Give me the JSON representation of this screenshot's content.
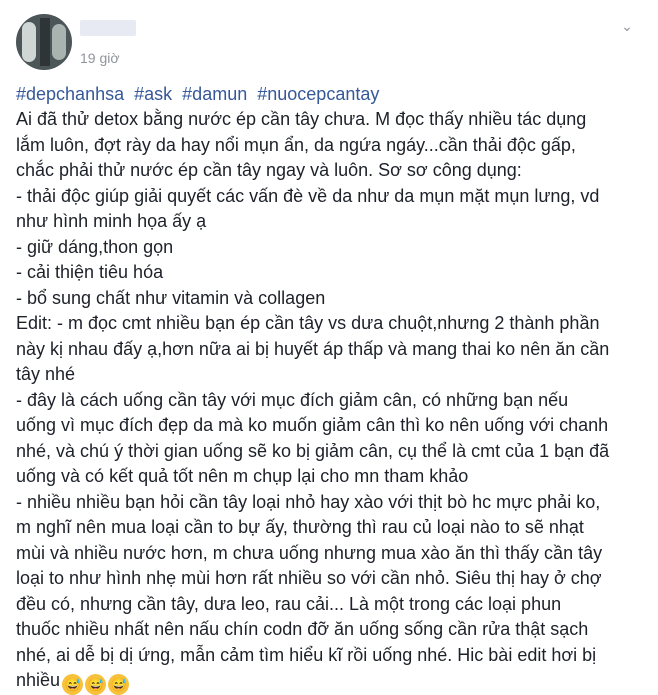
{
  "post": {
    "time": "19 giờ",
    "hashtags": [
      "#depchanhsa",
      "#ask",
      "#damun",
      "#nuocepcantay"
    ],
    "lines": [
      "Ai đã thử detox bằng nước ép cần tây chưa. M đọc thấy nhiều tác dụng",
      "lắm luôn, đợt rày da hay nổi mụn ẩn, da ngứa ngáy...cần thải độc gấp,",
      "chắc phải thử nước ép cần tây ngay và luôn. Sơ sơ công dụng:",
      "- thải độc giúp giải quyết các vấn đè về da như da mụn mặt mụn lưng, vd",
      "như hình minh họa ấy ạ",
      "- giữ dáng,thon gọn",
      "- cải thiện tiêu hóa",
      "- bổ sung chất như vitamin và collagen",
      "Edit: - m đọc cmt nhiều bạn ép cần tây vs dưa chuột,nhưng 2 thành phần",
      "này kị nhau đấy ạ,hơn nữa ai bị huyết áp thấp và mang thai ko nên ăn cần",
      "tây nhé",
      "- đây là cách uống cần tây với mục đích giảm cân, có những bạn nếu",
      "uống vì mục đích đẹp da mà ko muốn giảm cân thì ko nên uống với chanh",
      "nhé, và chú ý thời gian uống sẽ ko bị giảm cân, cụ thể là cmt của 1 bạn đã",
      "uống và có kết quả tốt nên m chụp lại cho mn tham khảo",
      "- nhiều nhiều bạn hỏi cần tây loại nhỏ hay xào với thịt bò hc mực phải ko,",
      "m nghĩ nên mua loại cần to bự ấy, thường thì rau củ loại nào to sẽ nhạt",
      "mùi và nhiều nước hơn, m chưa uống nhưng mua xào ăn thì thấy cần tây",
      "loại to như hình nhẹ mùi hơn rất nhiều so với cần nhỏ. Siêu thị hay ở chợ",
      "đều có, nhưng cần tây, dưa leo, rau cải... Là một trong các loại phun",
      "thuốc nhiều nhất nên nấu chín codn đỡ ăn uống sống cần rửa thật sạch",
      "nhé, ai dễ bị dị ứng, mẫn cảm tìm hiểu kĩ rồi uống nhé. Hic bài edit hơi bị",
      "nhiều"
    ],
    "emojis": [
      "😅",
      "😅",
      "😅"
    ]
  },
  "icons": {
    "menu": "chevron-down-icon"
  }
}
